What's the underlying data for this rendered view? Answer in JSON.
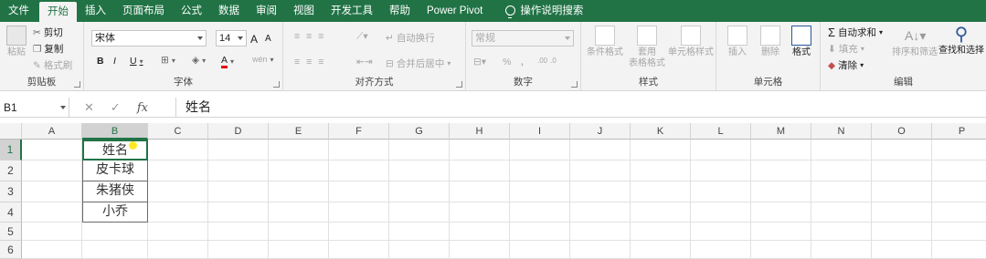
{
  "tabs": [
    "文件",
    "开始",
    "插入",
    "页面布局",
    "公式",
    "数据",
    "审阅",
    "视图",
    "开发工具",
    "帮助",
    "Power Pivot",
    "操作说明搜索"
  ],
  "clipboard": {
    "paste": "粘贴",
    "cut": "剪切",
    "copy": "复制",
    "format_painter": "格式刷",
    "label": "剪贴板"
  },
  "font": {
    "name": "宋体",
    "size": "14",
    "grow": "A",
    "shrink": "A",
    "bold": "B",
    "italic": "I",
    "underline": "U",
    "label": "字体",
    "wen": "wén"
  },
  "alignment": {
    "wrap": "自动换行",
    "merge": "合并后居中",
    "label": "对齐方式"
  },
  "number": {
    "format": "常规",
    "percent": "%",
    "comma": ",",
    "label": "数字"
  },
  "styles": {
    "conditional": "条件格式",
    "table_line1": "套用",
    "table_line2": "表格格式",
    "cell": "单元格样式",
    "label": "样式"
  },
  "cells": {
    "insert": "插入",
    "delete": "删除",
    "format": "格式",
    "label": "单元格"
  },
  "editing": {
    "autosum": "自动求和",
    "fill": "填充",
    "clear": "清除",
    "sort": "排序和筛选",
    "find": "查找和选择",
    "label": "编辑",
    "sigma": "Σ"
  },
  "formula_bar": {
    "name_box": "B1",
    "cancel": "✕",
    "enter": "✓",
    "fx": "fx",
    "content": "姓名"
  },
  "columns": [
    "A",
    "B",
    "C",
    "D",
    "E",
    "F",
    "G",
    "H",
    "I",
    "J",
    "K",
    "L",
    "M",
    "N",
    "O",
    "P"
  ],
  "rows": [
    "1",
    "2",
    "3",
    "4",
    "5",
    "6"
  ],
  "cells_data": {
    "B1": "姓名",
    "B2": "皮卡球",
    "B3": "朱猪侠",
    "B4": "小乔"
  }
}
